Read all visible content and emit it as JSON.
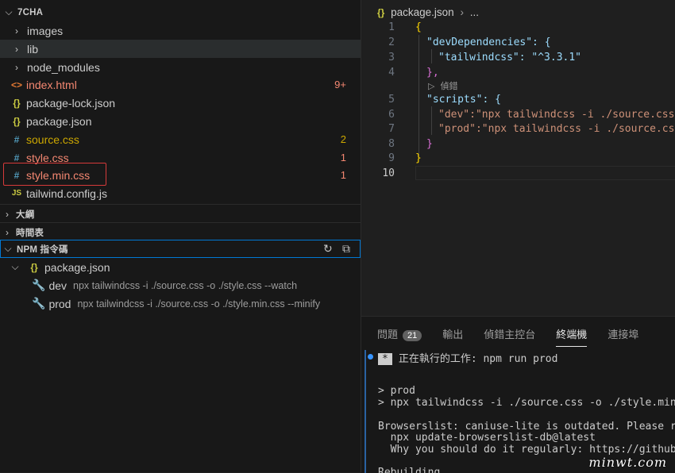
{
  "explorer": {
    "root": "7CHA",
    "items": [
      {
        "label": "images",
        "type": "folder",
        "color": "#cccccc",
        "badge": ""
      },
      {
        "label": "lib",
        "type": "folder",
        "color": "#cccccc",
        "badge": ""
      },
      {
        "label": "node_modules",
        "type": "folder",
        "color": "#cccccc",
        "badge": ""
      },
      {
        "label": "index.html",
        "icon": "<>",
        "color": "#f48771",
        "icon_color": "#e37933",
        "badge": "9+"
      },
      {
        "label": "package-lock.json",
        "icon": "{}",
        "color": "#cccccc",
        "icon_color": "#cbcb41",
        "badge": ""
      },
      {
        "label": "package.json",
        "icon": "{}",
        "color": "#cccccc",
        "icon_color": "#cbcb41",
        "badge": ""
      },
      {
        "label": "source.css",
        "icon": "#",
        "color": "#cca700",
        "icon_color": "#519aba",
        "badge": "2"
      },
      {
        "label": "style.css",
        "icon": "#",
        "color": "#f48771",
        "icon_color": "#519aba",
        "badge": "1"
      },
      {
        "label": "style.min.css",
        "icon": "#",
        "color": "#f48771",
        "icon_color": "#519aba",
        "badge": "1"
      },
      {
        "label": "tailwind.config.js",
        "icon": "JS",
        "color": "#cccccc",
        "icon_color": "#cbcb41",
        "badge": ""
      }
    ]
  },
  "sections": {
    "outline": "大綱",
    "timeline": "時間表",
    "npm": "NPM 指令碼"
  },
  "npm_scripts": {
    "file": "package.json",
    "scripts": [
      {
        "name": "dev",
        "cmd": "npx tailwindcss -i ./source.css -o ./style.css --watch"
      },
      {
        "name": "prod",
        "cmd": "npx tailwindcss -i ./source.css -o ./style.min.css --minify"
      }
    ]
  },
  "editor": {
    "breadcrumb_icon": "{}",
    "breadcrumb_file": "package.json",
    "breadcrumb_more": "...",
    "codelens": "偵錯",
    "lines": [
      {
        "n": "1",
        "text": "{"
      },
      {
        "n": "2",
        "text": "\"devDependencies\": {"
      },
      {
        "n": "3",
        "text": "\"tailwindcss\": \"^3.3.1\""
      },
      {
        "n": "4",
        "text": "},"
      },
      {
        "n": "5",
        "text": "\"scripts\": {"
      },
      {
        "n": "6",
        "text": "\"dev\":\"npx tailwindcss -i ./source.css -o ./style.css --watch\""
      },
      {
        "n": "7",
        "text": "\"prod\":\"npx tailwindcss -i ./source.css -o ./style.min.css --minify\""
      },
      {
        "n": "8",
        "text": "}"
      },
      {
        "n": "9",
        "text": "}"
      },
      {
        "n": "10",
        "text": ""
      }
    ]
  },
  "panel": {
    "tabs": [
      {
        "label": "問題",
        "count": "21"
      },
      {
        "label": "輸出"
      },
      {
        "label": "偵錯主控台"
      },
      {
        "label": "終端機",
        "active": true
      },
      {
        "label": "連接埠"
      }
    ],
    "terminal": {
      "task_star": "*",
      "task_text": "正在執行的工作: npm run prod",
      "lines": [
        "> prod",
        "> npx tailwindcss -i ./source.css -o ./style.min.css --minify",
        "",
        "Browserslist: caniuse-lite is outdated. Please run:",
        "  npx update-browserslist-db@latest",
        "  Why you should do it regularly: https://github.com/browserslist/update-db#readme",
        "",
        "Rebuilding..."
      ]
    }
  },
  "watermark": "minwt.com"
}
